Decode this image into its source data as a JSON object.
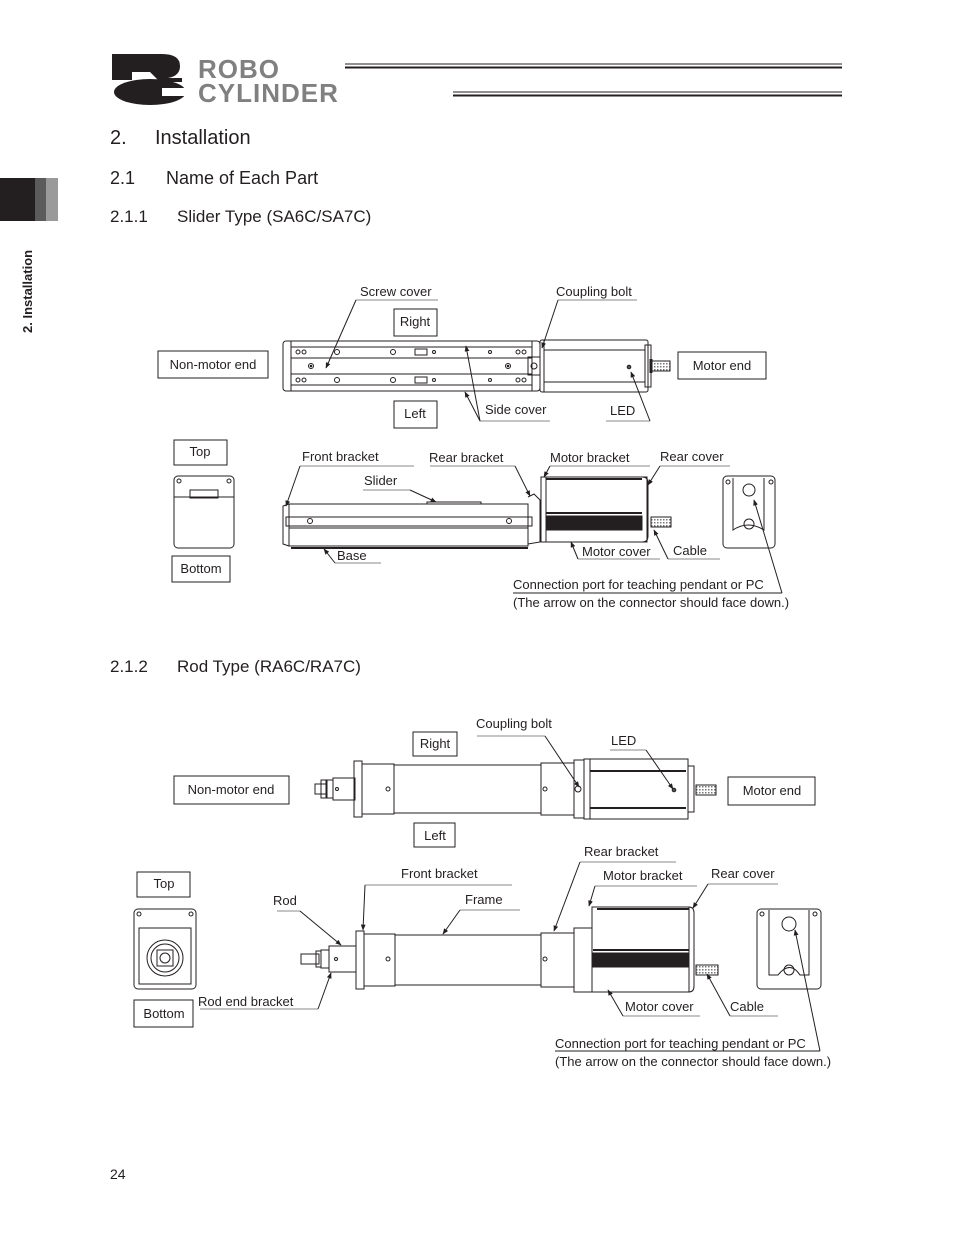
{
  "header": {
    "logo_mark": "RC",
    "logo_line1": "ROBO",
    "logo_line2": "CYLINDER"
  },
  "side_tab": {
    "label": "2. Installation"
  },
  "headings": {
    "h1": {
      "num": "2.",
      "text": "Installation"
    },
    "h2": {
      "num": "2.1",
      "text": "Name of Each Part"
    },
    "h3_slider": {
      "num": "2.1.1",
      "text": "Slider Type (SA6C/SA7C)"
    },
    "h3_rod": {
      "num": "2.1.2",
      "text": "Rod Type (RA6C/RA7C)"
    }
  },
  "slider_diagram": {
    "boxes": {
      "right": "Right",
      "left": "Left",
      "non_motor_end": "Non-motor end",
      "motor_end": "Motor end",
      "top": "Top",
      "bottom": "Bottom"
    },
    "labels": {
      "screw_cover": "Screw cover",
      "coupling_bolt": "Coupling bolt",
      "side_cover": "Side cover",
      "led": "LED",
      "front_bracket": "Front bracket",
      "rear_bracket": "Rear bracket",
      "motor_bracket": "Motor bracket",
      "rear_cover": "Rear cover",
      "slider": "Slider",
      "base": "Base",
      "motor_cover": "Motor cover",
      "cable": "Cable",
      "connection_port": "Connection port for teaching pendant or PC",
      "connection_note": "(The arrow on the connector should face down.)"
    }
  },
  "rod_diagram": {
    "boxes": {
      "right": "Right",
      "left": "Left",
      "non_motor_end": "Non-motor end",
      "motor_end": "Motor end",
      "top": "Top",
      "bottom": "Bottom"
    },
    "labels": {
      "coupling_bolt": "Coupling bolt",
      "led": "LED",
      "rear_bracket": "Rear bracket",
      "front_bracket": "Front bracket",
      "motor_bracket": "Motor bracket",
      "rear_cover": "Rear cover",
      "rod": "Rod",
      "frame": "Frame",
      "rod_end_bracket": "Rod end bracket",
      "motor_cover": "Motor cover",
      "cable": "Cable",
      "connection_port": "Connection port for teaching pendant or PC",
      "connection_note": "(The arrow on the connector should face down.)"
    }
  },
  "footer": {
    "page_number": "24"
  }
}
